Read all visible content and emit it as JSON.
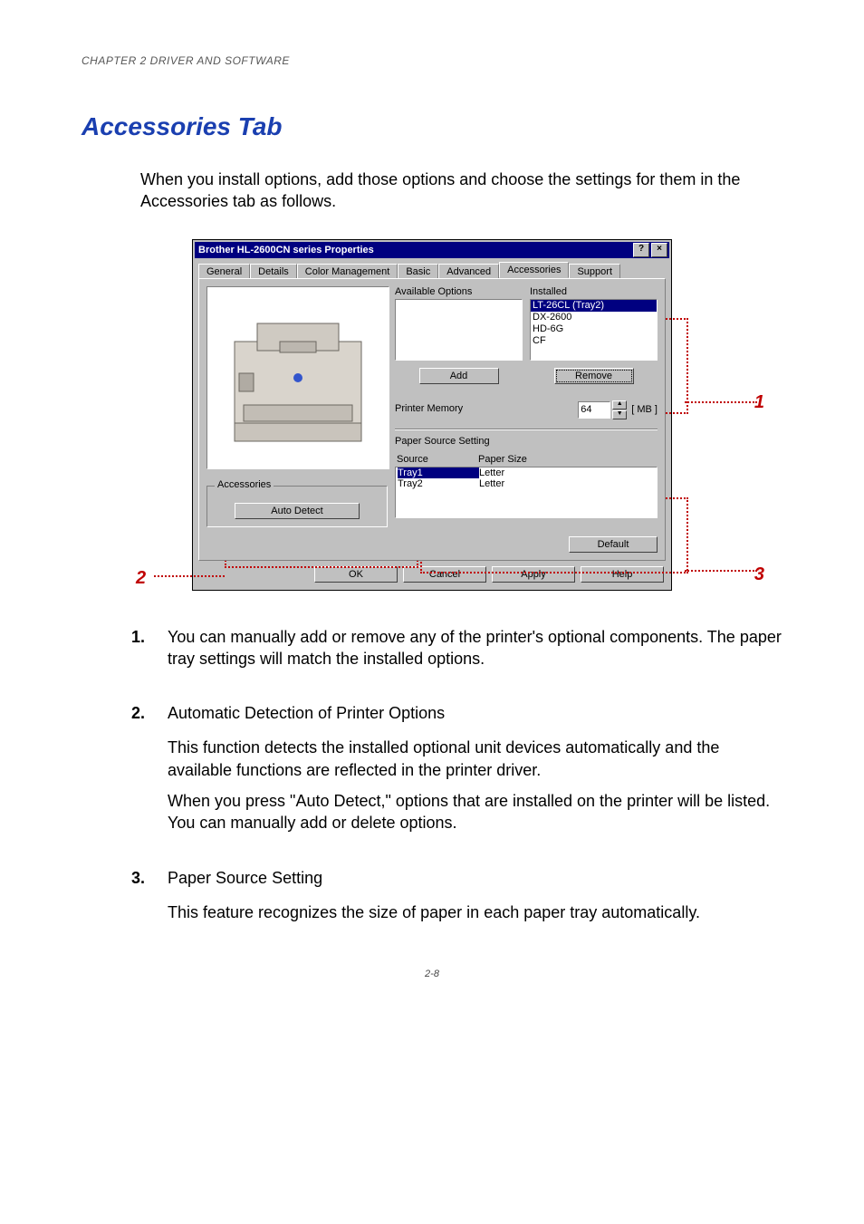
{
  "header": {
    "chapter": "CHAPTER 2 DRIVER AND SOFTWARE"
  },
  "title": "Accessories Tab",
  "intro": "When you install options, add those options and choose the settings for them in the Accessories tab as follows.",
  "callouts": {
    "c1": "1",
    "c2": "2",
    "c3": "3"
  },
  "dialog": {
    "title": "Brother HL-2600CN series Properties",
    "help_btn": "?",
    "close_btn": "×",
    "tabs": [
      "General",
      "Details",
      "Color Management",
      "Basic",
      "Advanced",
      "Accessories",
      "Support"
    ],
    "active_tab_index": 5,
    "available_label": "Available Options",
    "installed_label": "Installed",
    "installed_items": [
      "LT-26CL (Tray2)",
      "DX-2600",
      "HD-6G",
      "CF"
    ],
    "installed_selected_index": 0,
    "add_btn": "Add",
    "remove_btn": "Remove",
    "printer_memory_label": "Printer Memory",
    "printer_memory_value": "64",
    "printer_memory_unit": "[ MB ]",
    "paper_source_setting_label": "Paper Source Setting",
    "source_col": "Source",
    "paper_size_col": "Paper Size",
    "paper_rows": [
      {
        "source": "Tray1",
        "size": "Letter"
      },
      {
        "source": "Tray2",
        "size": "Letter"
      }
    ],
    "paper_selected_index": 0,
    "accessories_group": "Accessories",
    "auto_detect_btn": "Auto Detect",
    "default_btn": "Default",
    "ok_btn": "OK",
    "cancel_btn": "Cancel",
    "apply_btn": "Apply",
    "help_btn2": "Help"
  },
  "items": {
    "n1": "1.",
    "t1": "You can manually add or remove any of the printer's optional components. The paper tray settings will match the installed options.",
    "n2": "2.",
    "t2_title": "Automatic Detection of Printer Options",
    "t2_a": "This function detects the installed optional unit devices automatically and the available functions are reflected in the printer driver.",
    "t2_b": "When you press \"Auto Detect,\" options that are installed on the printer will be listed. You can manually add or delete options.",
    "n3": "3.",
    "t3_title": "Paper Source Setting",
    "t3_a": "This feature recognizes the size of paper in each paper tray automatically."
  },
  "page_number": "2-8"
}
